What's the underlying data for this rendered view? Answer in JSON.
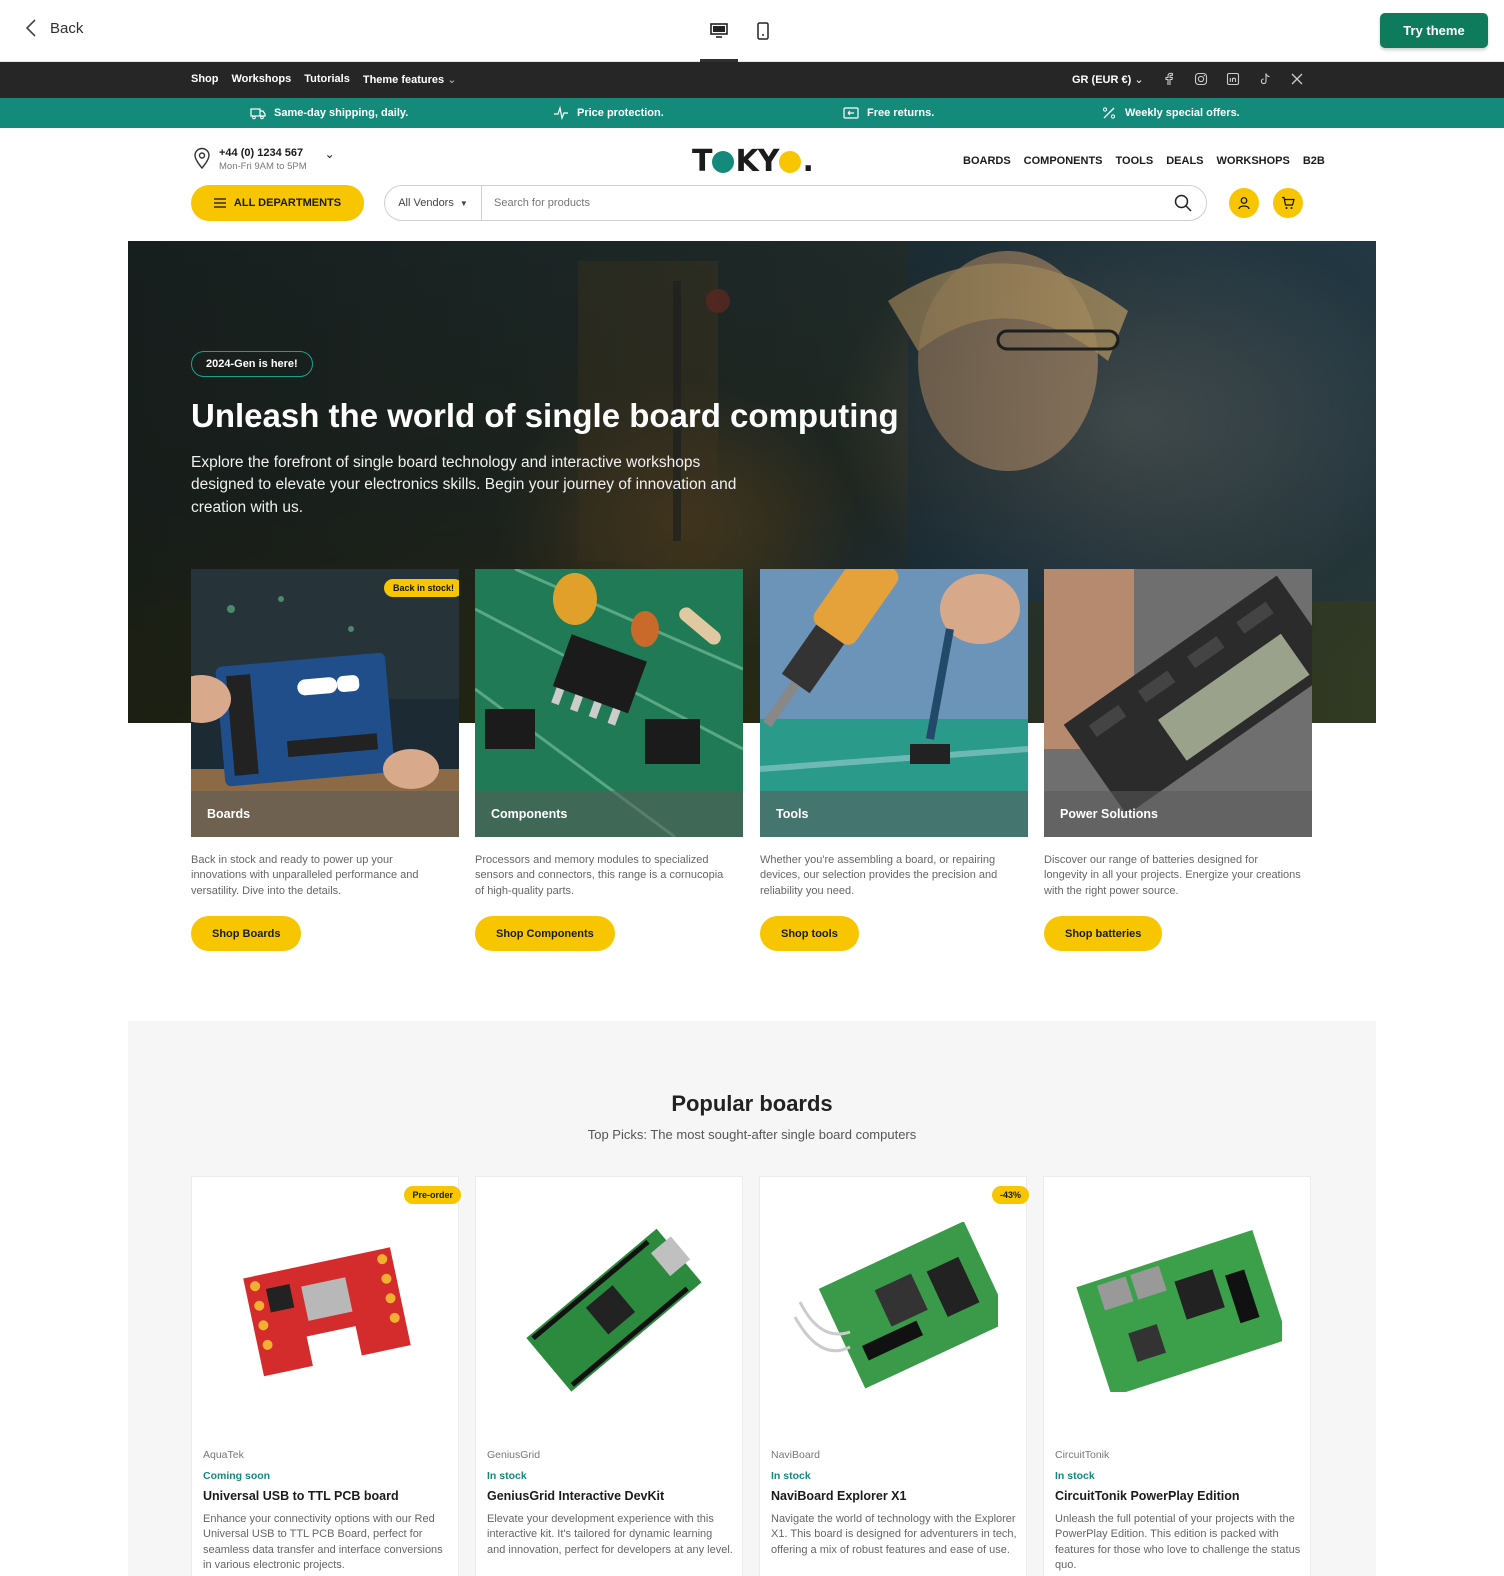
{
  "preview": {
    "back_label": "Back",
    "try_label": "Try theme"
  },
  "topnav": {
    "links": [
      "Shop",
      "Workshops",
      "Tutorials",
      "Theme features"
    ],
    "currency": "GR (EUR €)"
  },
  "promo": [
    "Same-day shipping, daily.",
    "Price protection.",
    "Free returns.",
    "Weekly special offers."
  ],
  "header": {
    "phone": "+44 (0) 1234 567",
    "hours": "Mon-Fri 9AM to 5PM",
    "logo": "TOKYO.",
    "nav": [
      "BOARDS",
      "COMPONENTS",
      "TOOLS",
      "DEALS",
      "WORKSHOPS",
      "B2B"
    ],
    "departments": "ALL DEPARTMENTS",
    "vendor": "All Vendors",
    "search_placeholder": "Search for products"
  },
  "hero": {
    "badge": "2024-Gen is here!",
    "title": "Unleash the world of single board computing",
    "subtitle": "Explore the forefront of single board technology and interactive workshops designed to elevate your electronics skills. Begin your journey of innovation and creation with us."
  },
  "categories": [
    {
      "label": "Boards",
      "tag": "Back in stock!",
      "desc": "Back in stock and ready to power up your innovations with unparalleled performance and versatility. Dive into the details.",
      "button": "Shop Boards"
    },
    {
      "label": "Components",
      "desc": "Processors and memory modules to specialized sensors and connectors, this range is a cornucopia of high-quality parts.",
      "button": "Shop Components"
    },
    {
      "label": "Tools",
      "desc": "Whether you're assembling a board, or repairing devices, our selection provides the precision and reliability you need.",
      "button": "Shop tools"
    },
    {
      "label": "Power Solutions",
      "desc": "Discover our range of batteries designed for longevity in all your projects. Energize your creations with the right power source.",
      "button": "Shop batteries"
    }
  ],
  "popular": {
    "title": "Popular boards",
    "subtitle": "Top Picks: The most sought-after single board computers",
    "products": [
      {
        "tag": "Pre-order",
        "vendor": "AquaTek",
        "status": "Coming soon",
        "name": "Universal USB to TTL PCB board",
        "desc": "Enhance your connectivity options with our Red Universal USB to TTL PCB Board, perfect for seamless data transfer and interface conversions in various electronic projects."
      },
      {
        "vendor": "GeniusGrid",
        "status": "In stock",
        "name": "GeniusGrid Interactive DevKit",
        "desc": "Elevate your development experience with this interactive kit. It's tailored for dynamic learning and innovation, perfect for developers at any level."
      },
      {
        "tag": "-43%",
        "vendor": "NaviBoard",
        "status": "In stock",
        "name": "NaviBoard Explorer X1",
        "desc": "Navigate the world of technology with the Explorer X1. This board is designed for adventurers in tech, offering a mix of robust features and ease of use."
      },
      {
        "vendor": "CircuitTonik",
        "status": "In stock",
        "name": "CircuitTonik PowerPlay Edition",
        "desc": "Unleash the full potential of your projects with the PowerPlay Edition. This edition is packed with features for those who love to challenge the status quo."
      }
    ]
  },
  "colors": {
    "accent_yellow": "#f7c600",
    "accent_green": "#138a7a",
    "dark_nav": "#262626",
    "try_button": "#0e7b5c"
  }
}
